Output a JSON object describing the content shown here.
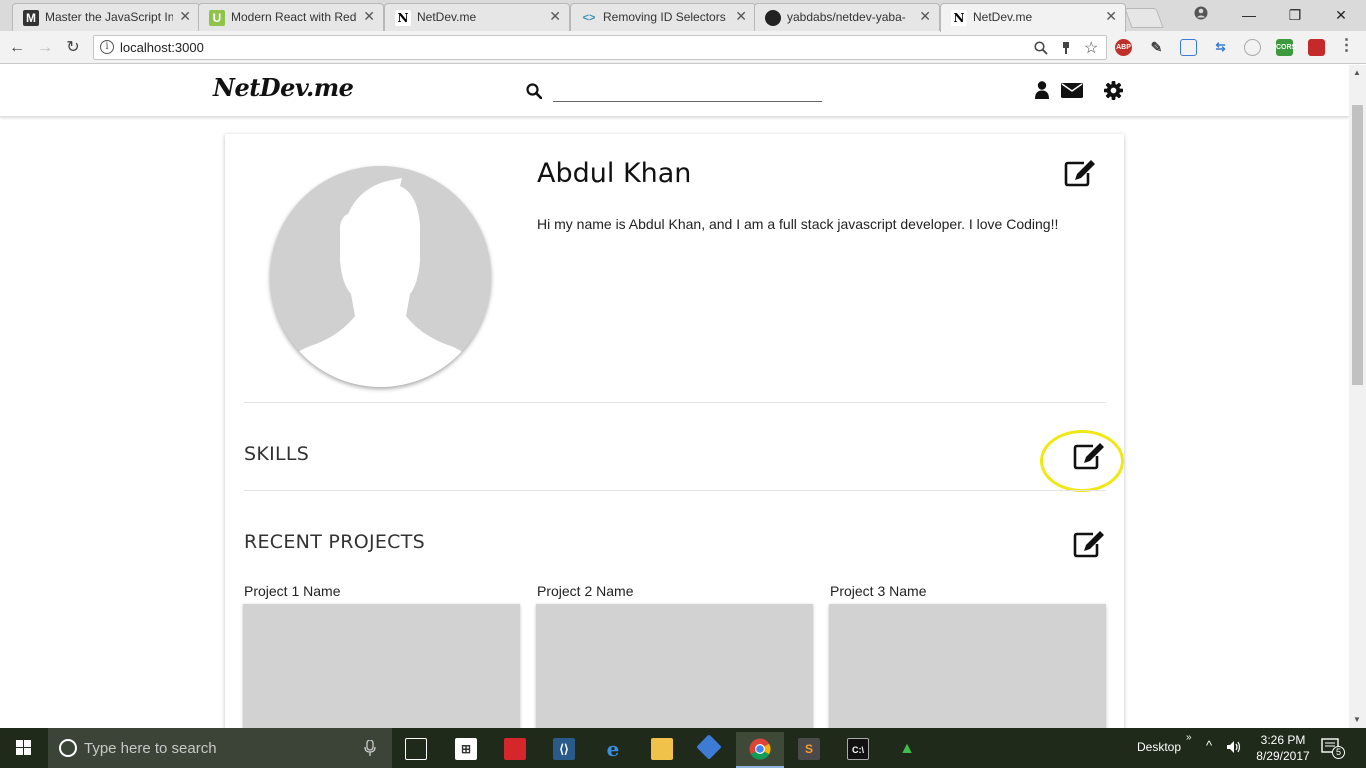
{
  "browser": {
    "tabs": [
      {
        "title": "Master the JavaScript In",
        "favicon": "M"
      },
      {
        "title": "Modern React with Red",
        "favicon": "U"
      },
      {
        "title": "NetDev.me",
        "favicon": "N"
      },
      {
        "title": "Removing ID Selectors",
        "favicon": "<>"
      },
      {
        "title": "yabdabs/netdev-yaba-",
        "favicon": "gh"
      },
      {
        "title": "NetDev.me",
        "favicon": "N"
      }
    ],
    "address": "localhost:3000",
    "extensions": {
      "abp": "ABP",
      "cors": "CORS"
    }
  },
  "site": {
    "logo": "NetDev.me",
    "profile": {
      "name": "Abdul Khan",
      "bio": "Hi my name is Abdul Khan, and I am a full stack javascript developer. I love Coding!!"
    },
    "sections": {
      "skills": "SKILLS",
      "projects": "RECENT PROJECTS"
    },
    "projects": [
      {
        "name": "Project 1 Name"
      },
      {
        "name": "Project 2 Name"
      },
      {
        "name": "Project 3 Name"
      }
    ]
  },
  "taskbar": {
    "search_placeholder": "Type here to search",
    "desktop_label": "Desktop",
    "time": "3:26 PM",
    "date": "8/29/2017",
    "notification_count": "5"
  },
  "colors": {
    "highlight": "#f0e814",
    "avatar_bg": "#d0d0d0",
    "taskbar_bg": "#1f2a1a"
  }
}
